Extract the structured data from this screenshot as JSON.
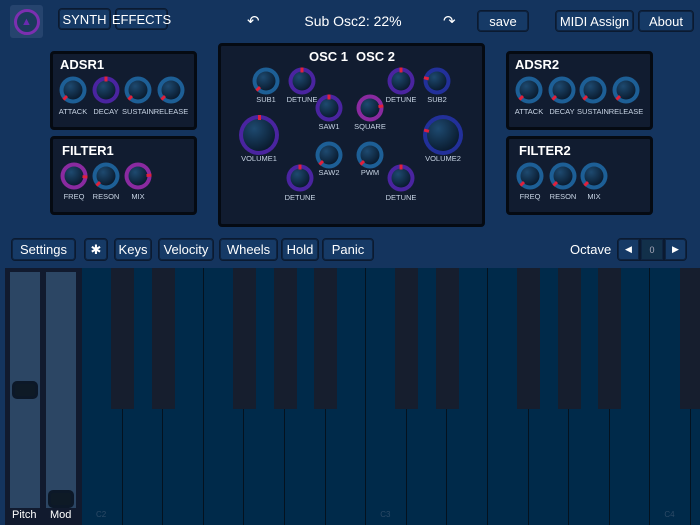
{
  "header": {
    "synth_label": "SYNTH",
    "effects_label": "EFFECTS",
    "status": "Sub Osc2: 22%",
    "save_label": "save",
    "midi_label": "MIDI Assign",
    "about_label": "About"
  },
  "adsr1": {
    "title": "ADSR1",
    "knobs": [
      {
        "label": "ATTACK",
        "value": 0,
        "color": "#1d5f96"
      },
      {
        "label": "DECAY",
        "value": 0.5,
        "color": "#4a24a0"
      },
      {
        "label": "SUSTAIN",
        "value": 0,
        "color": "#1d5f96"
      },
      {
        "label": "RELEASE",
        "value": 0,
        "color": "#1d5f96"
      }
    ]
  },
  "filter1": {
    "title": "FILTER1",
    "knobs": [
      {
        "label": "FREQ",
        "value": 0.85,
        "color": "#8a2aa0"
      },
      {
        "label": "RESON",
        "value": 0,
        "color": "#1d5f96"
      },
      {
        "label": "MIX",
        "value": 0.82,
        "color": "#8a2aa0"
      }
    ]
  },
  "adsr2": {
    "title": "ADSR2",
    "knobs": [
      {
        "label": "ATTACK",
        "value": 0,
        "color": "#1d5f96"
      },
      {
        "label": "DECAY",
        "value": 0,
        "color": "#1d5f96"
      },
      {
        "label": "SUSTAIN",
        "value": 0,
        "color": "#1d5f96"
      },
      {
        "label": "RELEASE",
        "value": 0,
        "color": "#1d5f96"
      }
    ]
  },
  "filter2": {
    "title": "FILTER2",
    "knobs": [
      {
        "label": "FREQ",
        "value": 0,
        "color": "#1d5f96"
      },
      {
        "label": "RESON",
        "value": 0,
        "color": "#1d5f96"
      },
      {
        "label": "MIX",
        "value": 0,
        "color": "#1d5f96"
      }
    ]
  },
  "osc": {
    "title1": "OSC 1",
    "title2": "OSC 2",
    "knobs": [
      {
        "label": "SUB1",
        "value": 0,
        "color": "#1d5f96"
      },
      {
        "label": "DETUNE",
        "value": 0.5,
        "color": "#4a24a0"
      },
      {
        "label": "SAW1",
        "value": 0.5,
        "color": "#4a24a0"
      },
      {
        "label": "SQUARE",
        "value": 0.8,
        "color": "#8a2aa0"
      },
      {
        "label": "DETUNE",
        "value": 0.5,
        "color": "#4a24a0"
      },
      {
        "label": "SUB2",
        "value": 0.22,
        "color": "#22309a"
      },
      {
        "label": "VOLUME1",
        "value": 0.5,
        "color": "#4a24a0"
      },
      {
        "label": "VOLUME2",
        "value": 0.22,
        "color": "#22309a"
      },
      {
        "label": "SAW2",
        "value": 0,
        "color": "#1d5f96"
      },
      {
        "label": "PWM",
        "value": 0,
        "color": "#1d5f96"
      },
      {
        "label": "DETUNE",
        "value": 0.5,
        "color": "#4a24a0"
      },
      {
        "label": "DETUNE",
        "value": 0.5,
        "color": "#4a24a0"
      }
    ]
  },
  "toolbar": {
    "settings": "Settings",
    "bluetooth_icon": "bluetooth-icon",
    "keys": "Keys",
    "velocity": "Velocity",
    "wheels": "Wheels",
    "hold": "Hold",
    "panic": "Panic",
    "octave_label": "Octave",
    "octave_value": "0"
  },
  "wheels": {
    "pitch_label": "Pitch",
    "mod_label": "Mod",
    "pitch_value": 0.5,
    "mod_value": 0
  },
  "keyboard": {
    "notes": [
      "C2",
      "C3",
      "C4"
    ]
  }
}
